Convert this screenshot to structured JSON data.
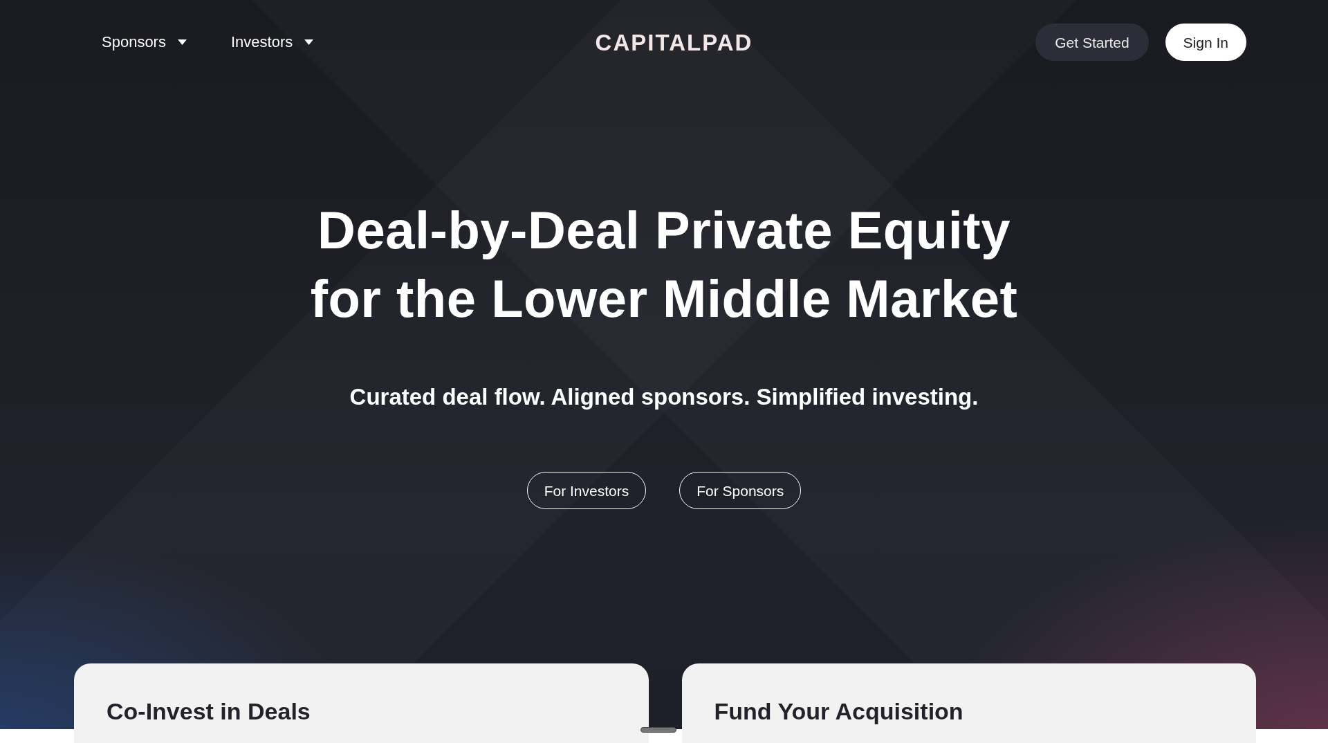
{
  "nav": {
    "menus": [
      {
        "label": "Sponsors"
      },
      {
        "label": "Investors"
      }
    ],
    "logo": "CAPITALPAD",
    "buttons": [
      {
        "label": "Get Started",
        "kind": "secondary"
      },
      {
        "label": "Sign In",
        "kind": "primary"
      }
    ]
  },
  "hero": {
    "headline_lines": [
      "Deal-by-Deal Private Equity",
      "for the Lower Middle Market"
    ],
    "subtitle": "Curated deal flow. Aligned sponsors. Simplified investing.",
    "buttons": [
      {
        "label": "For Investors"
      },
      {
        "label": "For Sponsors"
      }
    ]
  },
  "cards": [
    {
      "title": "Co-Invest in Deals"
    },
    {
      "title": "Fund Your Acquisition"
    }
  ]
}
